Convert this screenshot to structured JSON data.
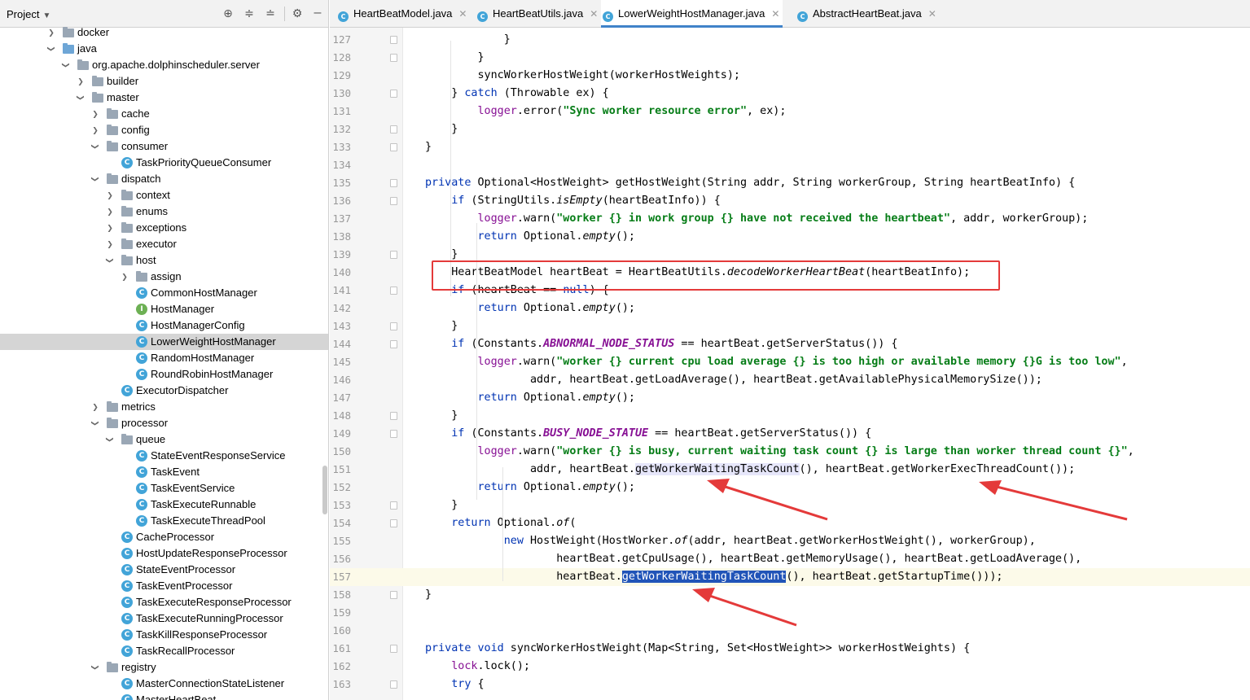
{
  "project_panel": {
    "title": "Project",
    "tree": [
      {
        "label": "docker",
        "depth": 0,
        "type": "folder",
        "arrow": "closed"
      },
      {
        "label": "java",
        "depth": 0,
        "type": "folder-blue",
        "arrow": "open"
      },
      {
        "label": "org.apache.dolphinscheduler.server",
        "depth": 1,
        "type": "folder",
        "arrow": "open"
      },
      {
        "label": "builder",
        "depth": 2,
        "type": "folder",
        "arrow": "closed"
      },
      {
        "label": "master",
        "depth": 2,
        "type": "folder",
        "arrow": "open"
      },
      {
        "label": "cache",
        "depth": 3,
        "type": "folder",
        "arrow": "closed"
      },
      {
        "label": "config",
        "depth": 3,
        "type": "folder",
        "arrow": "closed"
      },
      {
        "label": "consumer",
        "depth": 3,
        "type": "folder",
        "arrow": "open"
      },
      {
        "label": "TaskPriorityQueueConsumer",
        "depth": 4,
        "type": "class"
      },
      {
        "label": "dispatch",
        "depth": 3,
        "type": "folder",
        "arrow": "open"
      },
      {
        "label": "context",
        "depth": 4,
        "type": "folder",
        "arrow": "closed"
      },
      {
        "label": "enums",
        "depth": 4,
        "type": "folder",
        "arrow": "closed"
      },
      {
        "label": "exceptions",
        "depth": 4,
        "type": "folder",
        "arrow": "closed"
      },
      {
        "label": "executor",
        "depth": 4,
        "type": "folder",
        "arrow": "closed"
      },
      {
        "label": "host",
        "depth": 4,
        "type": "folder",
        "arrow": "open"
      },
      {
        "label": "assign",
        "depth": 5,
        "type": "folder",
        "arrow": "closed"
      },
      {
        "label": "CommonHostManager",
        "depth": 5,
        "type": "class"
      },
      {
        "label": "HostManager",
        "depth": 5,
        "type": "interface"
      },
      {
        "label": "HostManagerConfig",
        "depth": 5,
        "type": "class"
      },
      {
        "label": "LowerWeightHostManager",
        "depth": 5,
        "type": "class",
        "selected": true
      },
      {
        "label": "RandomHostManager",
        "depth": 5,
        "type": "class"
      },
      {
        "label": "RoundRobinHostManager",
        "depth": 5,
        "type": "class"
      },
      {
        "label": "ExecutorDispatcher",
        "depth": 4,
        "type": "class"
      },
      {
        "label": "metrics",
        "depth": 3,
        "type": "folder",
        "arrow": "closed"
      },
      {
        "label": "processor",
        "depth": 3,
        "type": "folder",
        "arrow": "open"
      },
      {
        "label": "queue",
        "depth": 4,
        "type": "folder",
        "arrow": "open"
      },
      {
        "label": "StateEventResponseService",
        "depth": 5,
        "type": "class"
      },
      {
        "label": "TaskEvent",
        "depth": 5,
        "type": "class"
      },
      {
        "label": "TaskEventService",
        "depth": 5,
        "type": "class"
      },
      {
        "label": "TaskExecuteRunnable",
        "depth": 5,
        "type": "class"
      },
      {
        "label": "TaskExecuteThreadPool",
        "depth": 5,
        "type": "class"
      },
      {
        "label": "CacheProcessor",
        "depth": 4,
        "type": "class"
      },
      {
        "label": "HostUpdateResponseProcessor",
        "depth": 4,
        "type": "class"
      },
      {
        "label": "StateEventProcessor",
        "depth": 4,
        "type": "class"
      },
      {
        "label": "TaskEventProcessor",
        "depth": 4,
        "type": "class"
      },
      {
        "label": "TaskExecuteResponseProcessor",
        "depth": 4,
        "type": "class"
      },
      {
        "label": "TaskExecuteRunningProcessor",
        "depth": 4,
        "type": "class"
      },
      {
        "label": "TaskKillResponseProcessor",
        "depth": 4,
        "type": "class"
      },
      {
        "label": "TaskRecallProcessor",
        "depth": 4,
        "type": "class"
      },
      {
        "label": "registry",
        "depth": 3,
        "type": "folder",
        "arrow": "open"
      },
      {
        "label": "MasterConnectionStateListener",
        "depth": 4,
        "type": "class"
      },
      {
        "label": "MasterHeartBeat",
        "depth": 4,
        "type": "class"
      }
    ]
  },
  "tabs": [
    {
      "label": "HeartBeatModel.java",
      "active": false
    },
    {
      "label": "HeartBeatUtils.java",
      "active": false
    },
    {
      "label": "LowerWeightHostManager.java",
      "active": true
    },
    {
      "label": "AbstractHeartBeat.java",
      "active": false
    }
  ],
  "code": {
    "current_line": 157,
    "lines": [
      {
        "n": 127,
        "t": [
          [
            "            }"
          ]
        ]
      },
      {
        "n": 128,
        "t": [
          [
            "        }"
          ]
        ]
      },
      {
        "n": 129,
        "t": [
          [
            "        syncWorkerHostWeight(workerHostWeights);"
          ]
        ]
      },
      {
        "n": 130,
        "t": [
          [
            "    } "
          ],
          [
            "catch",
            "kw"
          ],
          [
            " (Throwable ex) {"
          ]
        ]
      },
      {
        "n": 131,
        "t": [
          [
            "        "
          ],
          [
            "logger",
            "lg"
          ],
          [
            ".error("
          ],
          [
            "\"Sync worker resource error\"",
            "str"
          ],
          [
            ", ex);"
          ]
        ]
      },
      {
        "n": 132,
        "t": [
          [
            "    }"
          ]
        ]
      },
      {
        "n": 133,
        "t": [
          [
            "}"
          ]
        ]
      },
      {
        "n": 134,
        "t": [
          [
            ""
          ]
        ]
      },
      {
        "n": 135,
        "t": [
          [
            "private",
            "kw"
          ],
          [
            " Optional<HostWeight> getHostWeight(String addr, String workerGroup, String heartBeatInfo) {"
          ]
        ]
      },
      {
        "n": 136,
        "t": [
          [
            "    "
          ],
          [
            "if",
            "kw"
          ],
          [
            " (StringUtils."
          ],
          [
            "isEmpty",
            "ital"
          ],
          [
            "(heartBeatInfo)) {"
          ]
        ]
      },
      {
        "n": 137,
        "t": [
          [
            "        "
          ],
          [
            "logger",
            "lg"
          ],
          [
            ".warn("
          ],
          [
            "\"worker {} in work group {} have not received the heartbeat\"",
            "str"
          ],
          [
            ", addr, workerGroup);"
          ]
        ]
      },
      {
        "n": 138,
        "t": [
          [
            "        "
          ],
          [
            "return",
            "kw"
          ],
          [
            " Optional."
          ],
          [
            "empty",
            "ital"
          ],
          [
            "();"
          ]
        ]
      },
      {
        "n": 139,
        "t": [
          [
            "    }"
          ]
        ]
      },
      {
        "n": 140,
        "t": [
          [
            "    HeartBeatModel heartBeat = HeartBeatUtils."
          ],
          [
            "decodeWorkerHeartBeat",
            "ital"
          ],
          [
            "(heartBeatInfo);"
          ]
        ]
      },
      {
        "n": 141,
        "t": [
          [
            "    "
          ],
          [
            "if",
            "kw"
          ],
          [
            " (heartBeat == "
          ],
          [
            "null",
            "kw"
          ],
          [
            ") {"
          ]
        ]
      },
      {
        "n": 142,
        "t": [
          [
            "        "
          ],
          [
            "return",
            "kw"
          ],
          [
            " Optional."
          ],
          [
            "empty",
            "ital"
          ],
          [
            "();"
          ]
        ]
      },
      {
        "n": 143,
        "t": [
          [
            "    }"
          ]
        ]
      },
      {
        "n": 144,
        "t": [
          [
            "    "
          ],
          [
            "if",
            "kw"
          ],
          [
            " (Constants."
          ],
          [
            "ABNORMAL_NODE_STATUS",
            "fld"
          ],
          [
            " == heartBeat.getServerStatus()) {"
          ]
        ]
      },
      {
        "n": 145,
        "t": [
          [
            "        "
          ],
          [
            "logger",
            "lg"
          ],
          [
            ".warn("
          ],
          [
            "\"worker {} current cpu load average {} is too high or available memory {}G is too low\"",
            "str"
          ],
          [
            ","
          ]
        ]
      },
      {
        "n": 146,
        "t": [
          [
            "                addr, heartBeat.getLoadAverage(), heartBeat.getAvailablePhysicalMemorySize());"
          ]
        ]
      },
      {
        "n": 147,
        "t": [
          [
            "        "
          ],
          [
            "return",
            "kw"
          ],
          [
            " Optional."
          ],
          [
            "empty",
            "ital"
          ],
          [
            "();"
          ]
        ]
      },
      {
        "n": 148,
        "t": [
          [
            "    }"
          ]
        ]
      },
      {
        "n": 149,
        "t": [
          [
            "    "
          ],
          [
            "if",
            "kw"
          ],
          [
            " (Constants."
          ],
          [
            "BUSY_NODE_STATUE",
            "fld"
          ],
          [
            " == heartBeat.getServerStatus()) {"
          ]
        ]
      },
      {
        "n": 150,
        "t": [
          [
            "        "
          ],
          [
            "logger",
            "lg"
          ],
          [
            ".warn("
          ],
          [
            "\"worker {} is busy, current waiting task count {} is large than worker thread count {}\"",
            "str"
          ],
          [
            ","
          ]
        ]
      },
      {
        "n": 151,
        "t": [
          [
            "                addr, heartBeat."
          ],
          [
            "getWorkerWaitingTaskCount",
            "usage"
          ],
          [
            "(), heartBeat.getWorkerExecThreadCount());"
          ]
        ]
      },
      {
        "n": 152,
        "t": [
          [
            "        "
          ],
          [
            "return",
            "kw"
          ],
          [
            " Optional."
          ],
          [
            "empty",
            "ital"
          ],
          [
            "();"
          ]
        ]
      },
      {
        "n": 153,
        "t": [
          [
            "    }"
          ]
        ]
      },
      {
        "n": 154,
        "t": [
          [
            "    "
          ],
          [
            "return",
            "kw"
          ],
          [
            " Optional."
          ],
          [
            "of",
            "ital"
          ],
          [
            "("
          ]
        ]
      },
      {
        "n": 155,
        "t": [
          [
            "            "
          ],
          [
            "new",
            "kw"
          ],
          [
            " HostWeight(HostWorker."
          ],
          [
            "of",
            "ital"
          ],
          [
            "(addr, heartBeat.getWorkerHostWeight(), workerGroup),"
          ]
        ]
      },
      {
        "n": 156,
        "t": [
          [
            "                    heartBeat.getCpuUsage(), heartBeat.getMemoryUsage(), heartBeat.getLoadAverage(),"
          ]
        ]
      },
      {
        "n": 157,
        "t": [
          [
            "                    heartBeat."
          ],
          [
            "getWorkerWaitingTaskCount",
            "sel"
          ],
          [
            "(), heartBeat.getStartupTime()));"
          ]
        ]
      },
      {
        "n": 158,
        "t": [
          [
            "}"
          ]
        ]
      },
      {
        "n": 159,
        "t": [
          [
            ""
          ]
        ]
      },
      {
        "n": 160,
        "t": [
          [
            ""
          ]
        ]
      },
      {
        "n": 161,
        "t": [
          [
            "private",
            "kw"
          ],
          [
            " "
          ],
          [
            "void",
            "kw"
          ],
          [
            " syncWorkerHostWeight(Map<String, Set<HostWeight>> workerHostWeights) {"
          ]
        ]
      },
      {
        "n": 162,
        "t": [
          [
            "    "
          ],
          [
            "lock",
            "lg"
          ],
          [
            ".lock();"
          ]
        ]
      },
      {
        "n": 163,
        "t": [
          [
            "    "
          ],
          [
            "try",
            "kw"
          ],
          [
            " {"
          ]
        ]
      }
    ]
  },
  "icons": {
    "project_caret": "chevron-down-icon",
    "locate": "crosshair-icon",
    "expand_all": "expand-all-icon",
    "collapse_all": "collapse-all-icon",
    "settings": "gear-icon"
  },
  "colors": {
    "keyword": "#0033b3",
    "string": "#067d17",
    "field": "#871094",
    "selection": "#2154b8",
    "annotation": "#e43a3a",
    "tab_active": "#4083c9"
  }
}
